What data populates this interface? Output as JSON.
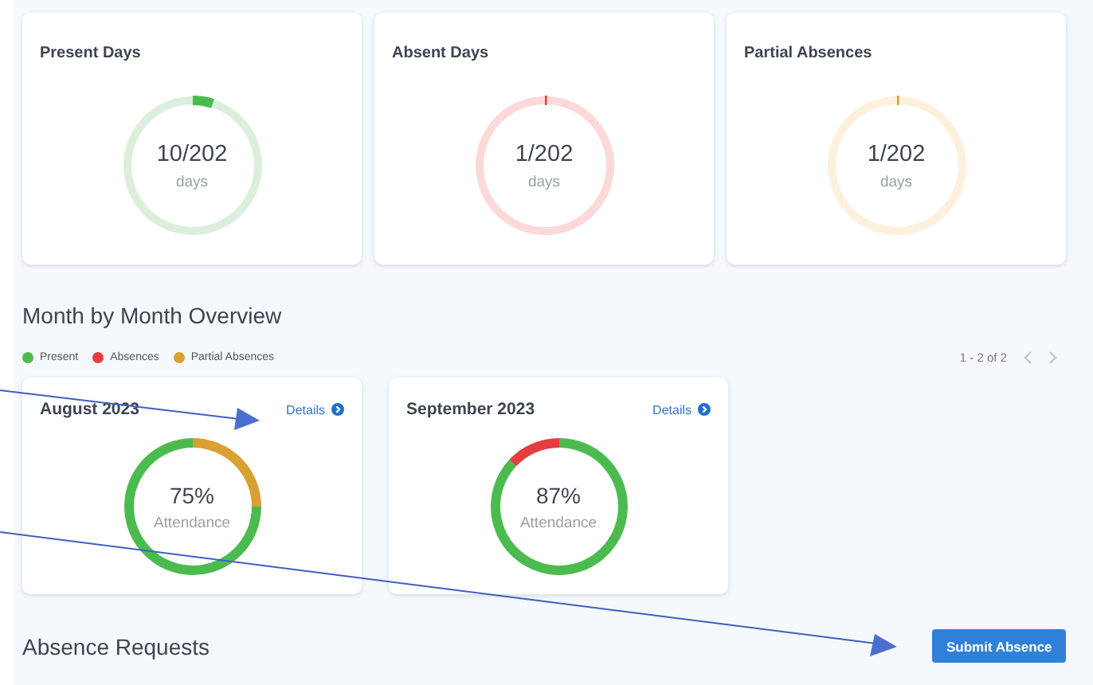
{
  "summary": [
    {
      "title": "Present Days",
      "value": "10/202",
      "unit": "days",
      "chart_data": {
        "type": "donut",
        "values": [
          4.95,
          95.05
        ],
        "colors": [
          "#4cbb4f",
          "#dcefdc"
        ]
      }
    },
    {
      "title": "Absent Days",
      "value": "1/202",
      "unit": "days",
      "chart_data": {
        "type": "donut",
        "values": [
          0.5,
          99.5
        ],
        "colors": [
          "#e53e3e",
          "#fcd9d9"
        ]
      }
    },
    {
      "title": "Partial Absences",
      "value": "1/202",
      "unit": "days",
      "chart_data": {
        "type": "donut",
        "values": [
          0.5,
          99.5
        ],
        "colors": [
          "#d9a033",
          "#fdf0dc"
        ]
      }
    }
  ],
  "overview": {
    "title": "Month by Month Overview",
    "legend": [
      {
        "label": "Present",
        "color": "#4cbb4f"
      },
      {
        "label": "Absences",
        "color": "#e53e3e"
      },
      {
        "label": "Partial Absences",
        "color": "#d9a033"
      }
    ],
    "pagination": "1 - 2 of 2",
    "months": [
      {
        "title": "August 2023",
        "link": "Details",
        "value": "75%",
        "caption": "Attendance",
        "chart_data": {
          "type": "donut",
          "values": [
            25,
            75
          ],
          "colors": [
            "#d9a033",
            "#4cbb4f"
          ]
        }
      },
      {
        "title": "September 2023",
        "link": "Details",
        "value": "87%",
        "caption": "Attendance",
        "chart_data": {
          "type": "donut",
          "values": [
            87,
            13
          ],
          "colors": [
            "#4cbb4f",
            "#e53e3e"
          ]
        }
      }
    ]
  },
  "requests": {
    "title": "Absence Requests",
    "button": "Submit Absence"
  }
}
